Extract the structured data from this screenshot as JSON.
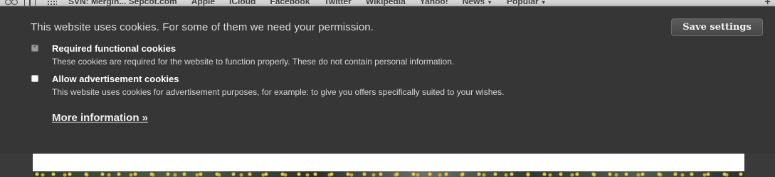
{
  "bookmarks_bar": {
    "items": [
      {
        "label": "SVN: Mergin... Sepcot.com",
        "has_menu": false
      },
      {
        "label": "Apple",
        "has_menu": false
      },
      {
        "label": "iCloud",
        "has_menu": false
      },
      {
        "label": "Facebook",
        "has_menu": false
      },
      {
        "label": "Twitter",
        "has_menu": false
      },
      {
        "label": "Wikipedia",
        "has_menu": false
      },
      {
        "label": "Yahoo!",
        "has_menu": false
      },
      {
        "label": "News",
        "has_menu": true
      },
      {
        "label": "Popular",
        "has_menu": true
      }
    ],
    "icons": [
      "reader-icon",
      "book-icon",
      "top-sites-grid-icon",
      "add-bookmark-icon"
    ]
  },
  "cookie_banner": {
    "heading": "This website uses cookies. For some of them we need your permission.",
    "save_button": "Save settings",
    "options": [
      {
        "title": "Required functional cookies",
        "description": "These cookies are required for the website to function properly. These do not contain personal information.",
        "checked": true,
        "disabled": true
      },
      {
        "title": "Allow advertisement cookies",
        "description": "This website uses cookies for advertisement purposes, for example: to give you offers specifically suited to your wishes.",
        "checked": false,
        "disabled": false
      }
    ],
    "more_info_link": "More information »"
  },
  "colors": {
    "banner_background": "#363636",
    "button_background": "#4f4f4f",
    "text_primary": "#ffffff",
    "text_secondary": "#d6d6d6"
  }
}
